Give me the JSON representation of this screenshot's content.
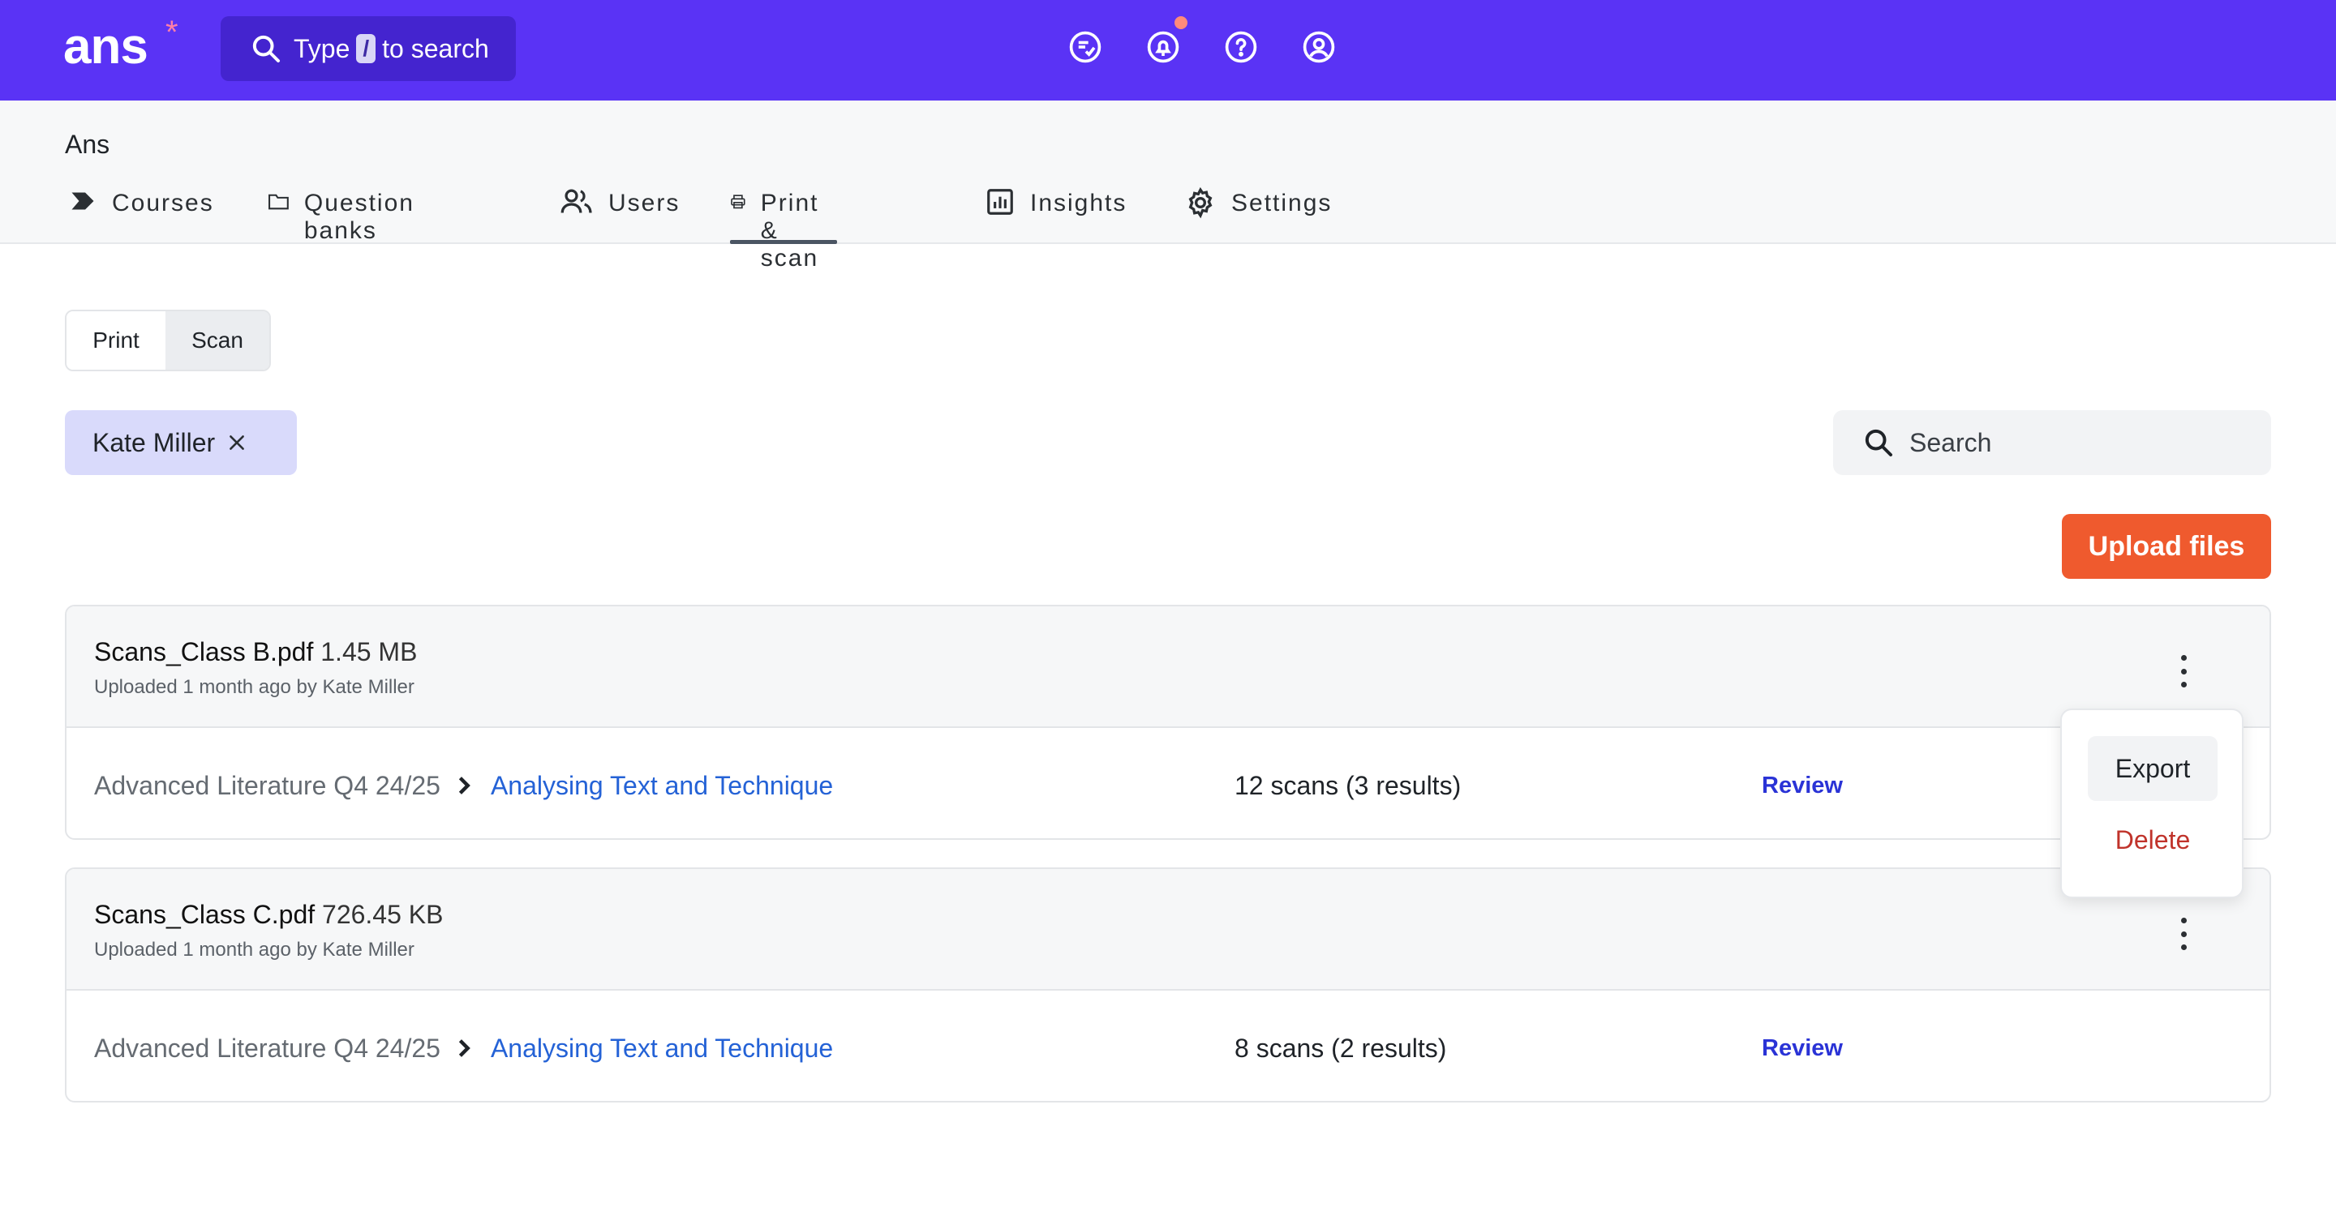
{
  "app": {
    "logo": "ans",
    "logo_mark": "*"
  },
  "topbar": {
    "search_prefix": "Type",
    "search_key": "/",
    "search_suffix": "to search",
    "icons": [
      "feedback-icon",
      "bell-icon",
      "help-icon",
      "account-icon"
    ]
  },
  "org": {
    "name": "Ans"
  },
  "nav": {
    "items": [
      {
        "label": "Courses",
        "icon": "courses-icon"
      },
      {
        "label": "Question banks",
        "icon": "folder-icon"
      },
      {
        "label": "Users",
        "icon": "users-icon"
      },
      {
        "label": "Print & scan",
        "icon": "printer-icon",
        "active": true
      },
      {
        "label": "Insights",
        "icon": "chart-icon"
      },
      {
        "label": "Settings",
        "icon": "gear-icon"
      }
    ]
  },
  "mode": {
    "print": "Print",
    "scan": "Scan",
    "selected": "Scan"
  },
  "filter": {
    "chip_label": "Kate Miller"
  },
  "search": {
    "placeholder": "Search"
  },
  "actions": {
    "upload": "Upload files"
  },
  "files": [
    {
      "name": "Scans_Class B.pdf",
      "size": "1.45 MB",
      "uploaded": "Uploaded 1 month ago by Kate Miller",
      "course": "Advanced Literature Q4 24/25",
      "topic": "Analysing Text and Technique",
      "scans": "12 scans (3 results)",
      "action": "Review"
    },
    {
      "name": "Scans_Class C.pdf",
      "size": "726.45 KB",
      "uploaded": "Uploaded 1 month ago by Kate Miller",
      "course": "Advanced Literature Q4 24/25",
      "topic": "Analysing Text and Technique",
      "scans": "8 scans (2 results)",
      "action": "Review"
    }
  ],
  "menu": {
    "export": "Export",
    "delete": "Delete"
  },
  "colors": {
    "brand": "#5a33f5",
    "accent": "#ef5a2e",
    "link": "#2462d6",
    "danger": "#c0332b"
  }
}
